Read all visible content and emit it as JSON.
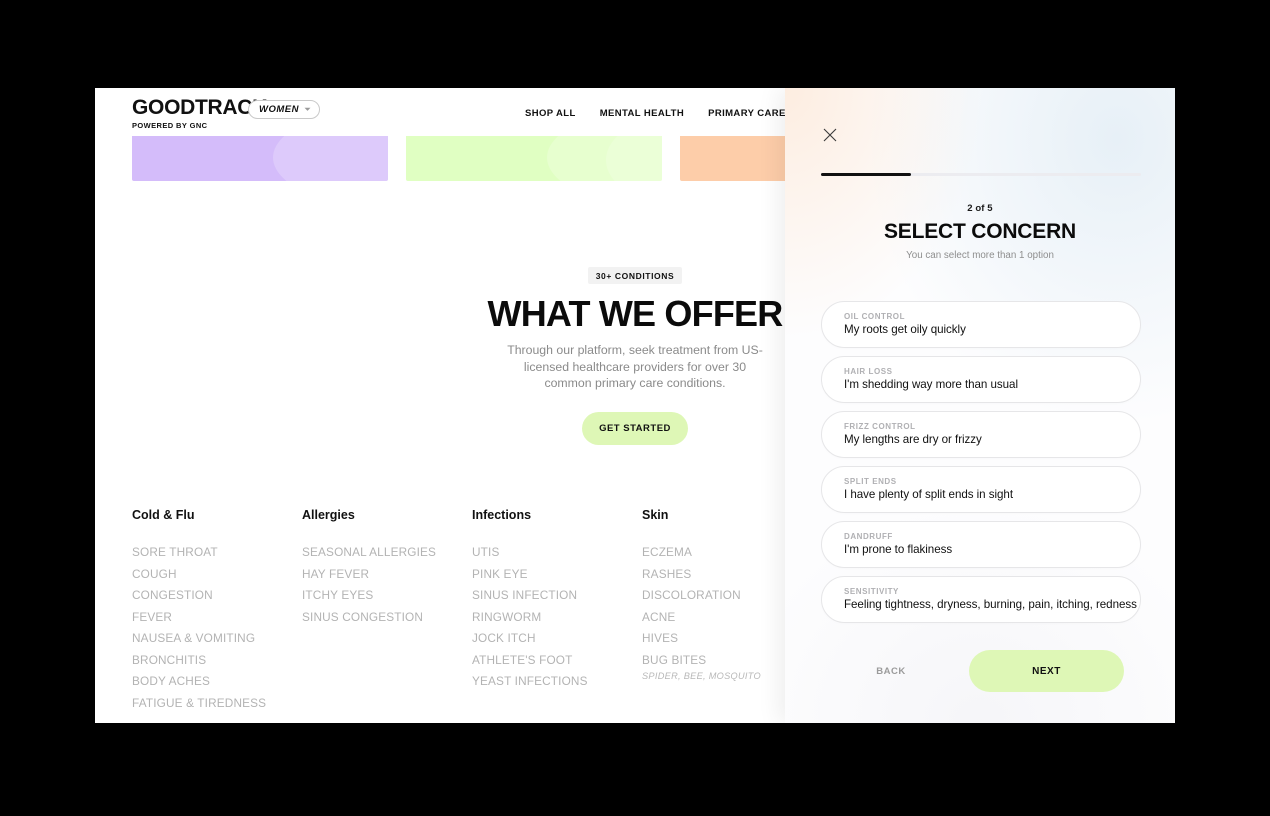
{
  "site": {
    "brand_name": "GOODTRACK",
    "brand_sub": "POWERED BY GNC",
    "segment_pill": {
      "label": "WOMEN",
      "icon": "chevron-down-icon"
    },
    "nav": [
      {
        "label": "SHOP ALL"
      },
      {
        "label": "MENTAL HEALTH"
      },
      {
        "label": "PRIMARY CARE"
      }
    ]
  },
  "tiles": [
    {
      "name": "tile-lavender",
      "color": "#D4BCFA"
    },
    {
      "name": "tile-green",
      "color": "#E0FFC2"
    },
    {
      "name": "tile-peach",
      "color": "#FDCDA9"
    }
  ],
  "hero": {
    "badge": "30+ CONDITIONS",
    "title": "WHAT WE OFFER",
    "subtitle": "Through our platform, seek treatment from US-licensed healthcare providers for over 30 common primary care conditions.",
    "cta_label": "GET STARTED",
    "cta_color": "#DEF7B6"
  },
  "conditions": [
    {
      "heading": "Cold & Flu",
      "items": [
        "SORE THROAT",
        "COUGH",
        "CONGESTION",
        "FEVER",
        "NAUSEA & VOMITING",
        "BRONCHITIS",
        "BODY ACHES",
        "FATIGUE & TIREDNESS"
      ]
    },
    {
      "heading": "Allergies",
      "items": [
        "SEASONAL ALLERGIES",
        "HAY FEVER",
        "ITCHY EYES",
        "SINUS CONGESTION"
      ]
    },
    {
      "heading": "Infections",
      "items": [
        "UTIS",
        "PINK EYE",
        "SINUS INFECTION",
        "RINGWORM",
        "JOCK ITCH",
        "ATHLETE'S FOOT",
        "YEAST INFECTIONS"
      ]
    },
    {
      "heading": "Skin",
      "items": [
        "ECZEMA",
        "RASHES",
        "DISCOLORATION",
        "ACNE",
        "HIVES",
        "BUG BITES"
      ],
      "note": "SPIDER, BEE, MOSQUITO"
    }
  ],
  "quiz": {
    "close_icon": "close-icon",
    "progress_percent": 28,
    "step_counter": "2 of 5",
    "title": "SELECT CONCERN",
    "hint": "You can select more than 1 option",
    "options": [
      {
        "tag": "OIL CONTROL",
        "desc": "My roots get oily quickly"
      },
      {
        "tag": "HAIR LOSS",
        "desc": "I'm shedding way more than usual"
      },
      {
        "tag": "FRIZZ CONTROL",
        "desc": "My lengths are dry or frizzy"
      },
      {
        "tag": "SPLIT ENDS",
        "desc": "I have plenty of split ends in sight"
      },
      {
        "tag": "DANDRUFF",
        "desc": "I'm prone to flakiness"
      },
      {
        "tag": "SENSITIVITY",
        "desc": "Feeling tightness, dryness, burning, pain, itching, redness"
      }
    ],
    "back_label": "BACK",
    "next_label": "NEXT",
    "next_color": "#DEF7B6"
  }
}
